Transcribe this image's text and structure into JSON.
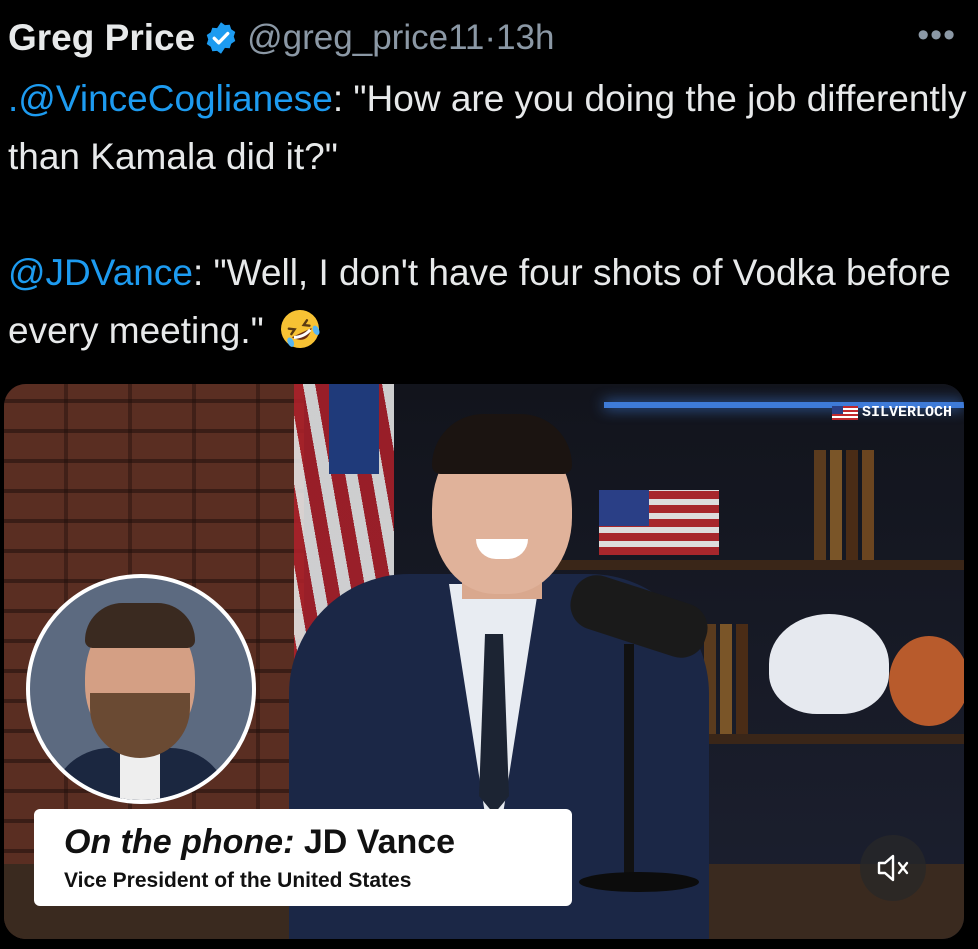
{
  "tweet": {
    "author_name": "Greg Price",
    "handle": "@greg_price11",
    "separator": "·",
    "time": "13h",
    "more_label": "•••",
    "line1_mention": ".@VinceCoglianese",
    "line1_text": ": \"How are you doing the job differently than Kamala did it?\"",
    "line2_mention": "@JDVance",
    "line2_text": ": \"Well, I don't have four shots of Vodka before every meeting.\""
  },
  "media": {
    "watermark": "SILVERLOCH",
    "lower_third_prefix": "On the phone:",
    "lower_third_name": "JD Vance",
    "lower_third_title": "Vice President of the United States",
    "mute_icon": "speaker-muted-icon"
  },
  "colors": {
    "background": "#000000",
    "text": "#e7e9ea",
    "muted": "#8b98a5",
    "link": "#1d9bf0",
    "verified": "#1d9bf0"
  }
}
